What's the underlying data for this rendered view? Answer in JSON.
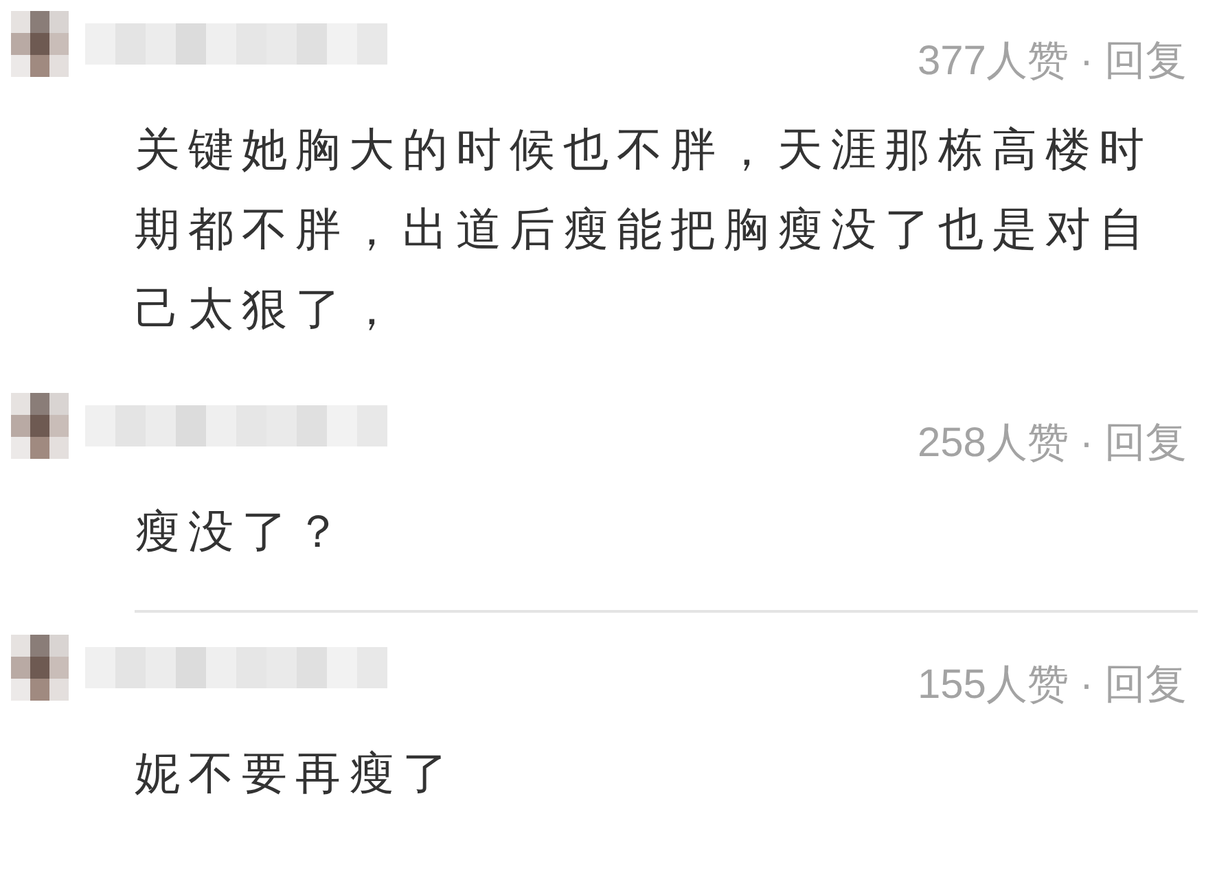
{
  "comments": [
    {
      "likes": "377人赞",
      "separator": "·",
      "reply": "回复",
      "text": "关键她胸大的时候也不胖，天涯那栋高楼时期都不胖，出道后瘦能把胸瘦没了也是对自己太狠了，",
      "divider": false
    },
    {
      "likes": "258人赞",
      "separator": "·",
      "reply": "回复",
      "text": "瘦没了？",
      "divider": true
    },
    {
      "likes": "155人赞",
      "separator": "·",
      "reply": "回复",
      "text": "妮不要再瘦了",
      "divider": false
    }
  ]
}
